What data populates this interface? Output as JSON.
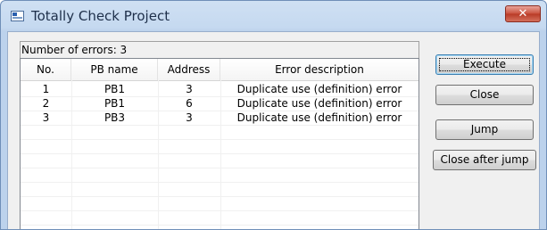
{
  "window": {
    "title": "Totally Check Project",
    "close_glyph": "✕"
  },
  "summary": {
    "error_count_text": "Number of errors: 3"
  },
  "table": {
    "columns": [
      "No.",
      "PB name",
      "Address",
      "Error description"
    ],
    "rows": [
      [
        "1",
        "PB1",
        "3",
        "Duplicate use (definition) error"
      ],
      [
        "2",
        "PB1",
        "6",
        "Duplicate use (definition) error"
      ],
      [
        "3",
        "PB3",
        "3",
        "Duplicate use (definition) error"
      ]
    ]
  },
  "buttons": {
    "execute": "Execute",
    "close": "Close",
    "jump": "Jump",
    "close_after_jump": "Close after jump"
  },
  "icons": {
    "app": "app-window-icon",
    "close": "close-icon"
  }
}
